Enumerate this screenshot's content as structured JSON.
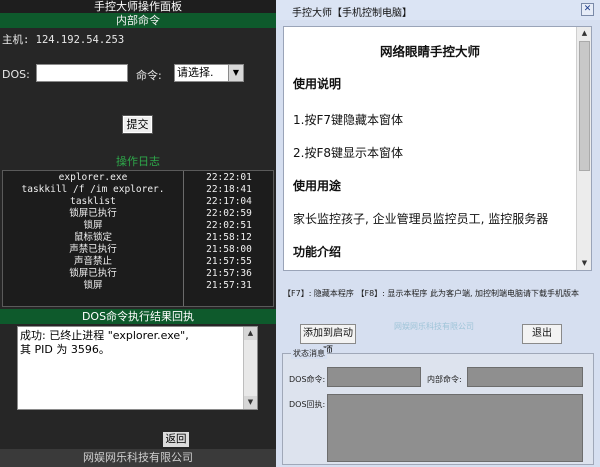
{
  "left": {
    "title": "手控大师操作面板",
    "subtitle": "内部命令",
    "host": "主机: 124.192.54.253",
    "dos_label": "DOS:",
    "dos_value": "",
    "cmd_label": "命令:",
    "select_value": "请选择.",
    "submit_label": "提交",
    "log_title": "操作日志",
    "log": [
      {
        "cmd": "explorer.exe",
        "time": "22:22:01"
      },
      {
        "cmd": "taskkill /f /im explorer.",
        "time": "22:18:41"
      },
      {
        "cmd": "tasklist",
        "time": "22:17:04"
      },
      {
        "cmd": "锁屏已执行",
        "time": "22:02:59"
      },
      {
        "cmd": "锁屏",
        "time": "22:02:51"
      },
      {
        "cmd": "鼠标锁定",
        "time": "21:58:12"
      },
      {
        "cmd": "声禁已执行",
        "time": "21:58:00"
      },
      {
        "cmd": "声音禁止",
        "time": "21:57:55"
      },
      {
        "cmd": "锁屏已执行",
        "time": "21:57:36"
      },
      {
        "cmd": "锁屏",
        "time": "21:57:31"
      }
    ],
    "result_title": "DOS命令执行结果回执",
    "result_text": "成功: 已终止进程 \"explorer.exe\",\n其 PID 为 3596。",
    "back_label": "返回",
    "footer": "网娱网乐科技有限公司"
  },
  "right": {
    "title": "手控大师【手机控制电脑】",
    "close_glyph": "✕",
    "doc": {
      "heading": "网络眼睛手控大师",
      "l1": "使用说明",
      "l2": "1.按F7键隐藏本窗体",
      "l3": "2.按F8键显示本窗体",
      "l4": "使用用途",
      "l5": "家长监控孩子, 企业管理员监控员工, 监控服务器",
      "l6": "功能介绍"
    },
    "hint": "【F7】: 隐藏本程序  【F8】: 显示本程序  此为客户端, 加控制端电脑请下载手机版本",
    "add_label": "添加到启动项",
    "exit_label": "退出",
    "faint_text": "网娱网乐科技有限公司",
    "status_title": "状态消息",
    "dos_cmd_label": "DOS命令:",
    "inner_cmd_label": "内部命令:",
    "dos_reply_label": "DOS回执:"
  }
}
